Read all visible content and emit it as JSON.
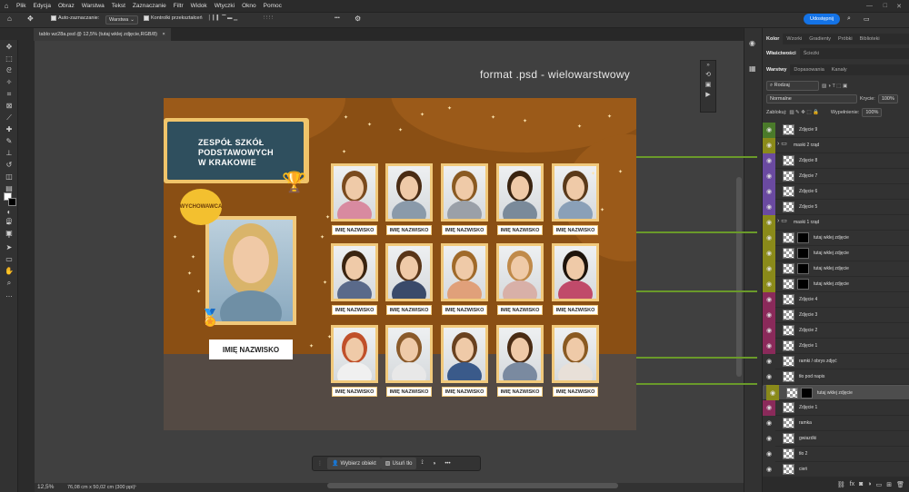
{
  "menu": [
    "Plik",
    "Edycja",
    "Obraz",
    "Warstwa",
    "Tekst",
    "Zaznaczanie",
    "Filtr",
    "Widok",
    "Wtyczki",
    "Okno",
    "Pomoc"
  ],
  "options": {
    "auto_select": "Auto-zaznaczanie:",
    "auto_select_target": "Warstwa",
    "transform_controls": "Kontrolki przekształceń",
    "more": "•••",
    "share": "Udostępnij"
  },
  "doc": {
    "tab_title": "tablo wz28a.psd @ 12,5% (tutaj wklej zdjęcie,RGB/8)",
    "close": "×"
  },
  "watermark": "format .psd - wielowarstwowy",
  "artboard": {
    "school": [
      "ZESPÓŁ SZKÓŁ",
      "PODSTAWOWYCH",
      "W KRAKOWIE"
    ],
    "badge": "WYCHOWAWCA",
    "teacher_name": "IMIĘ NAZWISKO",
    "student_label": "IMIĘ NAZWISKO"
  },
  "context_bar": {
    "select_subject": "Wybierz obiekt",
    "remove_bg": "Usuń tło",
    "more": "•••"
  },
  "status": {
    "zoom": "12,5%",
    "size": "76,08 cm x 50,02 cm (300 ppi)"
  },
  "panel": {
    "tabs_top": [
      "Kolor",
      "Wzorki",
      "Gradienty",
      "Próbki",
      "Biblioteki"
    ],
    "tabs_mid": [
      "Właściwości",
      "Ścieżki"
    ],
    "tabs_layers": [
      "Warstwy",
      "Dopasowania",
      "Kanały"
    ],
    "filter_kind": "Rodzaj",
    "blend_mode": "Normalne",
    "opacity_label": "Krycie:",
    "opacity": "100%",
    "lock_label": "Zablokuj:",
    "fill_label": "Wypełnienie:",
    "fill": "100%"
  },
  "layers": [
    {
      "name": "Zdjęcie 9",
      "color": "#4a7a2a",
      "type": "img"
    },
    {
      "name": "maski 2 rząd",
      "color": "#8a8a1a",
      "type": "folder"
    },
    {
      "name": "Zdjęcie 8",
      "color": "#6a4aa0",
      "type": "img"
    },
    {
      "name": "Zdjęcie 7",
      "color": "#6a4aa0",
      "type": "img"
    },
    {
      "name": "Zdjęcie 6",
      "color": "#6a4aa0",
      "type": "img"
    },
    {
      "name": "Zdjęcie 5",
      "color": "#6a4aa0",
      "type": "img"
    },
    {
      "name": "maski 1 rząd",
      "color": "#8a8a1a",
      "type": "folder"
    },
    {
      "name": "tutaj wklej zdjęcie",
      "color": "#8a8a1a",
      "type": "mask"
    },
    {
      "name": "tutaj wklej zdjęcie",
      "color": "#8a8a1a",
      "type": "mask"
    },
    {
      "name": "tutaj wklej zdjęcie",
      "color": "#8a8a1a",
      "type": "mask"
    },
    {
      "name": "tutaj wklej zdjęcie",
      "color": "#8a8a1a",
      "type": "mask"
    },
    {
      "name": "Zdjęcie 4",
      "color": "#8a2a5a",
      "type": "img"
    },
    {
      "name": "Zdjęcie 3",
      "color": "#8a2a5a",
      "type": "img"
    },
    {
      "name": "Zdjęcie 2",
      "color": "#8a2a5a",
      "type": "img"
    },
    {
      "name": "Zdjęcie 1",
      "color": "#8a2a5a",
      "type": "img"
    },
    {
      "name": "ramki / obrys zdjęć",
      "color": "#323232",
      "type": "img"
    },
    {
      "name": "tło pod napis",
      "color": "#323232",
      "type": "img"
    },
    {
      "name": "tutaj wklej zdjęcie",
      "color": "#8a8a1a",
      "type": "mask",
      "selected": true
    },
    {
      "name": "Zdjęcie 1",
      "color": "#8a2a5a",
      "type": "img"
    },
    {
      "name": "ramka",
      "color": "#323232",
      "type": "img"
    },
    {
      "name": "gwiazdki",
      "color": "#323232",
      "type": "img"
    },
    {
      "name": "tło 2",
      "color": "#323232",
      "type": "img"
    },
    {
      "name": "cień",
      "color": "#323232",
      "type": "img"
    }
  ]
}
